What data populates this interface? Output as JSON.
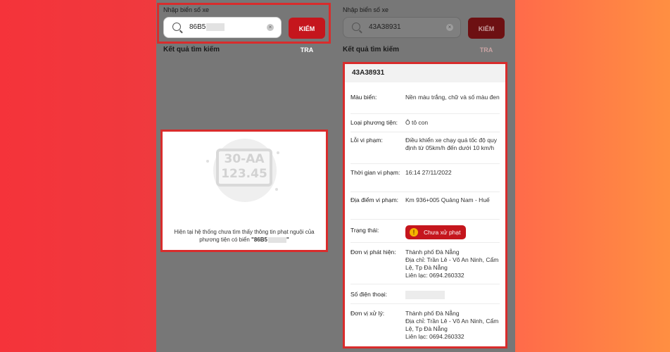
{
  "left_screen": {
    "field_label": "Nhập biển số xe",
    "search_value": "86B5",
    "check_button": "KIỂM TRA",
    "results_title": "Kết quả tìm kiếm",
    "plate_line1": "30-AA",
    "plate_line2": "123.45",
    "empty_message": "Hiện tại hệ thống chưa tìm thấy thông tin phạt nguội của phương tiện có biển",
    "empty_plate": "\"86B5",
    "empty_plate_end": "\""
  },
  "right_screen": {
    "field_label": "Nhập biển số xe",
    "search_value": "43A38931",
    "check_button": "KIỂM TRA",
    "results_title": "Kết quả tìm kiếm",
    "plate": "43A38931",
    "rows": [
      {
        "label": "Màu biển:",
        "value": "Nền màu trắng, chữ và số màu đen"
      },
      {
        "label": "Loại phương tiện:",
        "value": "Ô tô con"
      },
      {
        "label": "Lỗi vi phạm:",
        "value": "Điều khiển xe chạy quá tốc độ quy định từ 05km/h đến dưới 10 km/h"
      },
      {
        "label": "Thời gian vi phạm:",
        "value": "16:14 27/11/2022"
      },
      {
        "label": "Địa điểm vi phạm:",
        "value": "Km 936+005 Quảng Nam - Huế"
      },
      {
        "label": "Trạng thái:",
        "value": "Chưa xử phạt"
      },
      {
        "label": "Đơn vị phát hiện:",
        "value": "Thành phố Đà Nẵng\nĐịa chỉ: Trần Lê - Võ An Ninh, Cẩm Lệ, Tp Đà Nẵng\nLiên lạc: 0694.260332"
      },
      {
        "label": "Số điện thoại:",
        "value": ""
      },
      {
        "label": "Đơn vị xử lý:",
        "value": "Thành phố Đà Nẵng\nĐịa chỉ: Trần Lê - Võ An Ninh, Cẩm Lệ, Tp Đà Nẵng\nLiên lạc: 0694.260332"
      }
    ]
  },
  "icons": {
    "search": "search-icon",
    "clear": "clear-icon",
    "warning": "warning-icon"
  },
  "colors": {
    "accent": "#c5161d",
    "highlight": "#d92c2c",
    "overlay": "#777777"
  }
}
